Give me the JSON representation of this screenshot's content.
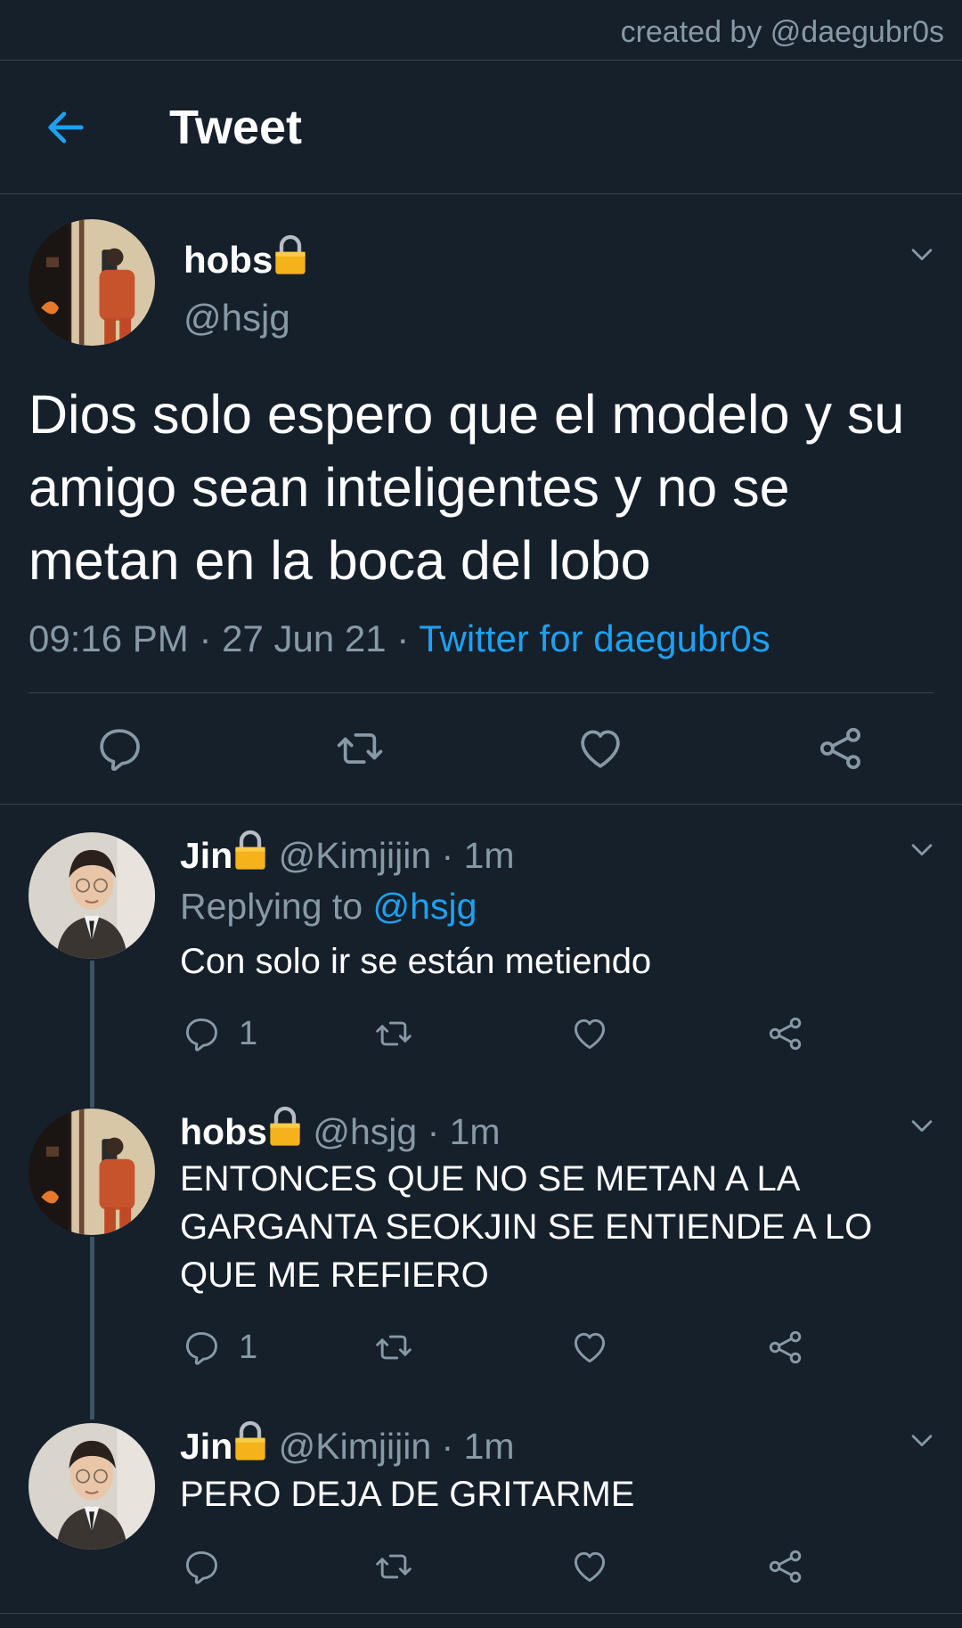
{
  "credit": "created by @daegubr0s",
  "header": {
    "title": "Tweet"
  },
  "colors": {
    "background": "#15202b",
    "accent": "#1da1f2",
    "muted": "#8899a6",
    "divider": "#38444d"
  },
  "main_tweet": {
    "name": "hobs",
    "handle": "@hsjg",
    "text": "Dios solo espero que el modelo y su amigo sean inteligentes y no se metan en la boca del lobo",
    "time": "09:16 PM",
    "date": "27 Jun 21",
    "source": "Twitter for daegubr0s",
    "icons": [
      "reply-icon",
      "retweet-icon",
      "like-icon",
      "share-icon"
    ]
  },
  "replies": [
    {
      "name": "Jin",
      "handle": "@Kimjijin",
      "time": "1m",
      "replying_label": "Replying to",
      "replying_handle": "@hsjg",
      "text": "Con solo ir se están metiendo",
      "reply_count": "1"
    },
    {
      "name": "hobs",
      "handle": "@hsjg",
      "time": "1m",
      "text": "ENTONCES QUE NO SE METAN A LA GARGANTA SEOKJIN SE ENTIENDE A LO QUE ME REFIERO",
      "reply_count": "1"
    },
    {
      "name": "Jin",
      "handle": "@Kimjijin",
      "time": "1m",
      "text": "PERO DEJA DE GRITARME",
      "reply_count": ""
    }
  ]
}
